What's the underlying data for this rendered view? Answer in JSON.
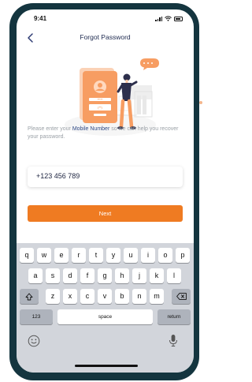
{
  "status_bar": {
    "time": "9:41"
  },
  "header": {
    "title": "Forgot Password"
  },
  "description": {
    "before": "Please enter your ",
    "highlight": "Mobile Number",
    "after": " so we can help you recover your password."
  },
  "phone_input": {
    "value": "+123 456 789"
  },
  "next_button": {
    "label": "Next"
  },
  "keyboard": {
    "row1": [
      "q",
      "w",
      "e",
      "r",
      "t",
      "y",
      "u",
      "i",
      "o",
      "p"
    ],
    "row2": [
      "a",
      "s",
      "d",
      "f",
      "g",
      "h",
      "j",
      "k",
      "l"
    ],
    "row3": [
      "z",
      "x",
      "c",
      "v",
      "b",
      "n",
      "m"
    ],
    "numbers_key": "123",
    "space_key": "space",
    "return_key": "return"
  },
  "illustration": {
    "card_label": "*****",
    "user_badge": "(**)"
  },
  "colors": {
    "accent": "#EF7B22",
    "title": "#1F2B50",
    "highlight": "#2F4A86",
    "frame": "#14353F"
  }
}
